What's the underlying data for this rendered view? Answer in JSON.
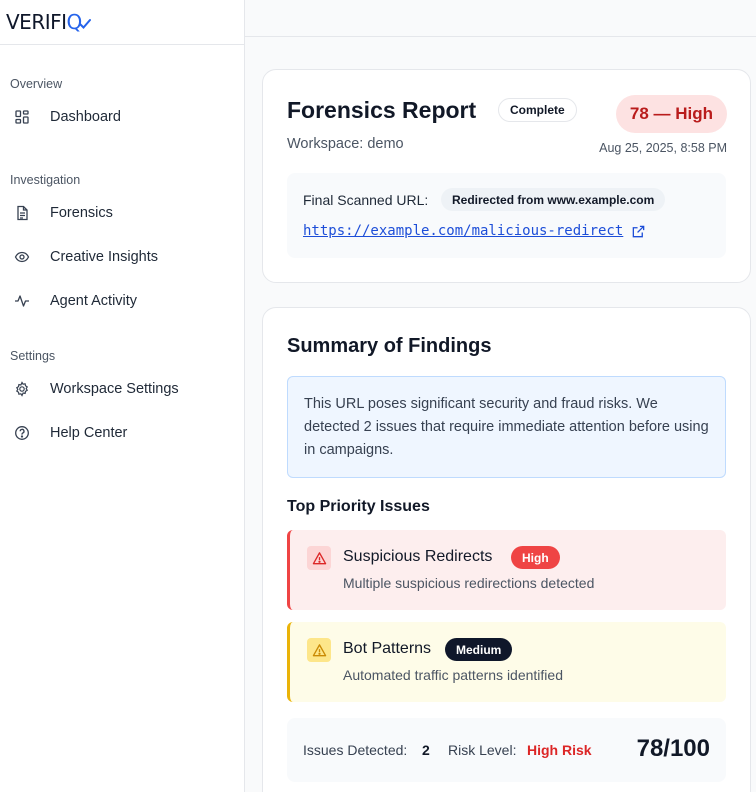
{
  "app": {
    "logo_prefix": "VERIFI",
    "logo_accent": "Q"
  },
  "sidebar": {
    "sections": [
      {
        "label": "Overview"
      },
      {
        "label": "Investigation"
      },
      {
        "label": "Settings"
      }
    ],
    "items": [
      {
        "label": "Dashboard",
        "icon": "grid-icon"
      },
      {
        "label": "Forensics",
        "icon": "document-icon"
      },
      {
        "label": "Creative Insights",
        "icon": "eye-icon"
      },
      {
        "label": "Agent Activity",
        "icon": "activity-icon"
      },
      {
        "label": "Workspace Settings",
        "icon": "gear-icon"
      },
      {
        "label": "Help Center",
        "icon": "help-circle-icon"
      }
    ]
  },
  "report": {
    "title": "Forensics Report",
    "status": "Complete",
    "risk_badge": "78 — High",
    "workspace": "Workspace: demo",
    "timestamp": "Aug 25, 2025, 8:58 PM",
    "url_label": "Final Scanned URL:",
    "redirect_note": "Redirected from www.example.com",
    "url": "https://example.com/malicious-redirect"
  },
  "summary": {
    "title": "Summary of Findings",
    "text": "This URL poses significant security and fraud risks. We detected 2 issues that require immediate attention before using in campaigns.",
    "issues_heading": "Top Priority Issues",
    "issues": [
      {
        "title": "Suspicious Redirects",
        "severity": "High",
        "description": "Multiple suspicious redirections detected"
      },
      {
        "title": "Bot Patterns",
        "severity": "Medium",
        "description": "Automated traffic patterns identified"
      }
    ],
    "stats": {
      "issues_label": "Issues Detected:",
      "issues_value": "2",
      "risk_label": "Risk Level:",
      "risk_value": "High Risk",
      "score": "78/100"
    }
  },
  "colors": {
    "accent": "#2563eb",
    "high": "#ef4444",
    "medium": "#eab308",
    "info_bg": "#eff6ff"
  }
}
